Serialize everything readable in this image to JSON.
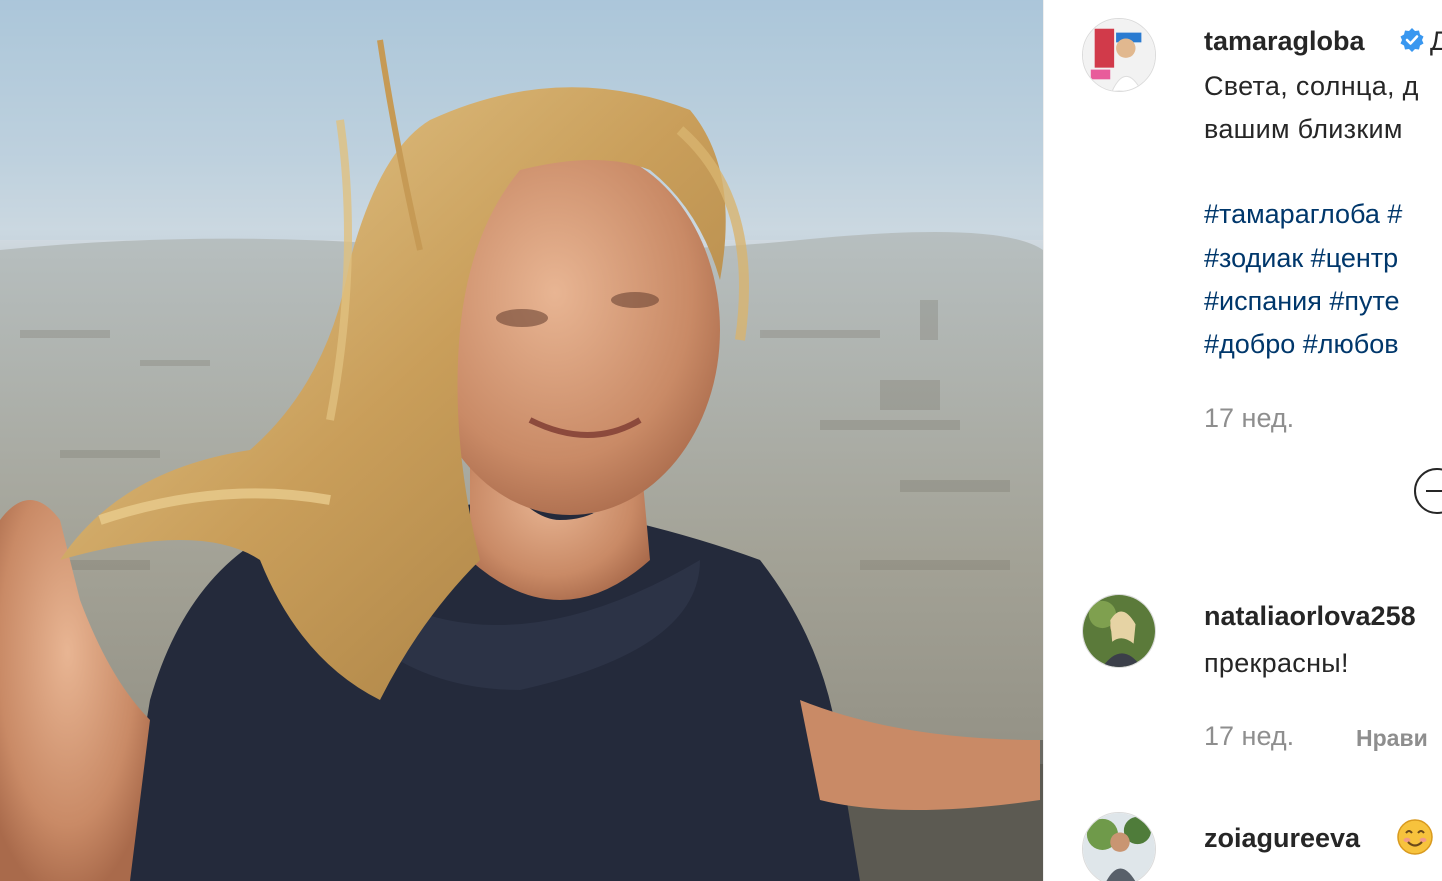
{
  "post": {
    "author": "tamaragloba",
    "caption_line1": "Света, солнца, д",
    "caption_line2": "вашим близким",
    "hashtag_lines": [
      "#тамараглоба #",
      "#зодиак #центр",
      "#испания #путе",
      "#добро #любов"
    ],
    "time": "17 нед."
  },
  "comments": [
    {
      "user": "nataliaorlova258",
      "text": "прекрасны!",
      "time": "17 нед.",
      "like_label": "Нрави"
    },
    {
      "user": "zoiagureeva"
    }
  ],
  "colors": {
    "link": "#00376b",
    "verified": "#3897f0",
    "muted": "#8e8e8e"
  },
  "icons": [
    "verified-badge-icon",
    "more-replies-icon",
    "smiling-emoji-icon"
  ]
}
